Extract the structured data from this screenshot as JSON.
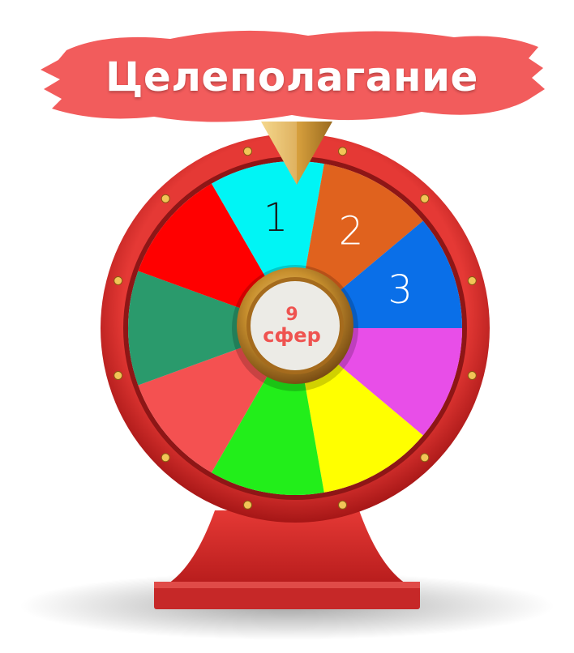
{
  "banner": {
    "title": "Целеполагание",
    "color": "#f25c5c"
  },
  "hub": {
    "count": "9",
    "label": "сфер"
  },
  "wheel": {
    "segments": [
      {
        "label": "",
        "color": "#f45151"
      },
      {
        "label": "",
        "color": "#2a9a6c"
      },
      {
        "label": "",
        "color": "#ff0000"
      },
      {
        "label": "1",
        "color": "#00f5f5"
      },
      {
        "label": "2",
        "color": "#e0621e"
      },
      {
        "label": "3",
        "color": "#0a6fe8"
      },
      {
        "label": "",
        "color": "#e84ee8"
      },
      {
        "label": "",
        "color": "#ffff00"
      },
      {
        "label": "",
        "color": "#22ee1a"
      }
    ],
    "rim_color": "#d42a2a",
    "pointer_color": "#c8962e"
  }
}
